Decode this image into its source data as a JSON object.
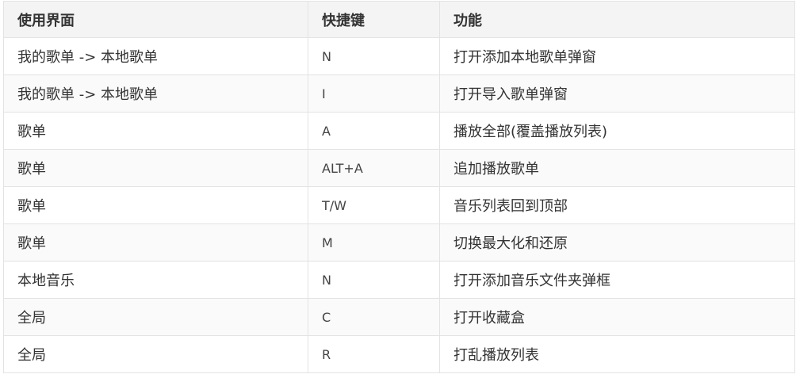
{
  "table": {
    "headers": [
      "使用界面",
      "快捷键",
      "功能"
    ],
    "rows": [
      [
        "我的歌单 -> 本地歌单",
        "N",
        "打开添加本地歌单弹窗"
      ],
      [
        "我的歌单 -> 本地歌单",
        "I",
        "打开导入歌单弹窗"
      ],
      [
        "歌单",
        "A",
        "播放全部(覆盖播放列表)"
      ],
      [
        "歌单",
        "ALT+A",
        "追加播放歌单"
      ],
      [
        "歌单",
        "T/W",
        "音乐列表回到顶部"
      ],
      [
        "歌单",
        "M",
        "切换最大化和还原"
      ],
      [
        "本地音乐",
        "N",
        "打开添加音乐文件夹弹框"
      ],
      [
        "全局",
        "C",
        "打开收藏盒"
      ],
      [
        "全局",
        "R",
        "打乱播放列表"
      ]
    ]
  },
  "colors": {
    "header_background": "#f4f4f4",
    "border": "#e3e3e3",
    "text": "#333333"
  }
}
